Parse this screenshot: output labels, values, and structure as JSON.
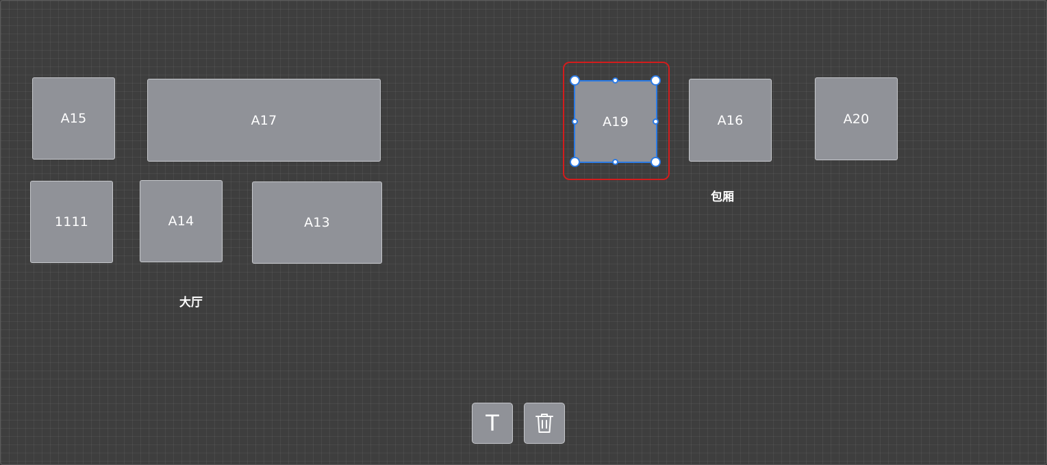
{
  "canvas": {
    "tables": [
      {
        "id": "A15",
        "label": "A15"
      },
      {
        "id": "A17",
        "label": "A17"
      },
      {
        "id": "1111",
        "label": "1111"
      },
      {
        "id": "A14",
        "label": "A14"
      },
      {
        "id": "A13",
        "label": "A13"
      },
      {
        "id": "A19",
        "label": "A19",
        "selected": true
      },
      {
        "id": "A16",
        "label": "A16"
      },
      {
        "id": "A20",
        "label": "A20"
      }
    ],
    "areas": [
      {
        "label": "大厅"
      },
      {
        "label": "包厢"
      }
    ]
  },
  "toolbar": {
    "text_tool": {
      "glyph": "T",
      "icon": "text-icon"
    },
    "delete_tool": {
      "icon": "trash-icon"
    }
  },
  "colors": {
    "canvas_bg": "#3e3e3e",
    "table_fill": "#909298",
    "selection_outline": "#d41c1c",
    "handle_border": "#2c7be5"
  }
}
